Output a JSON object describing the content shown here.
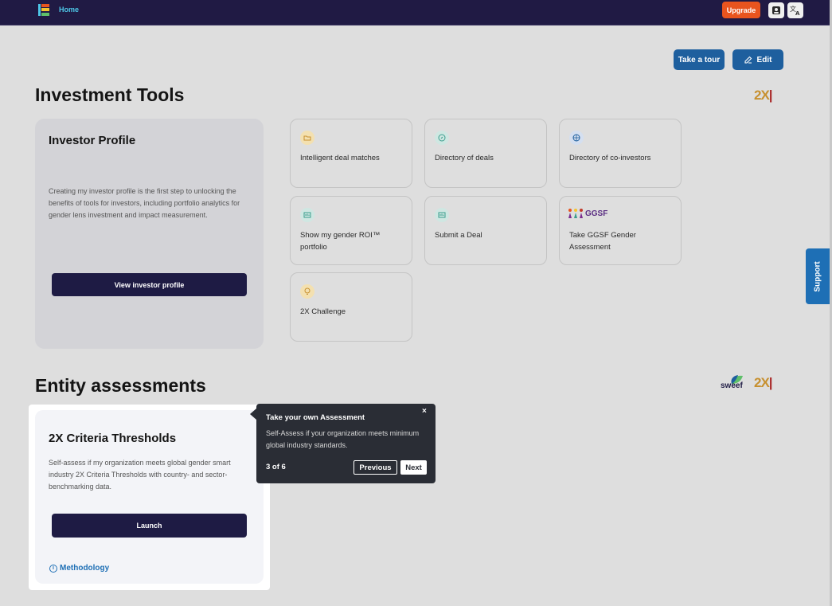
{
  "nav": {
    "home": "Home",
    "upgrade": "Upgrade"
  },
  "toolbar": {
    "tour": "Take a tour",
    "edit": "Edit"
  },
  "investment_tools": {
    "title": "Investment Tools",
    "logo_text": "2X",
    "profile": {
      "title": "Investor Profile",
      "description": "Creating my investor profile is the first step to unlocking the benefits of tools for investors, including portfolio analytics for gender lens investment and impact measurement.",
      "button": "View investor profile"
    },
    "tools": [
      {
        "label": "Intelligent deal matches",
        "icon": "folder-icon"
      },
      {
        "label": "Directory of deals",
        "icon": "compass-icon"
      },
      {
        "label": "Directory of co-investors",
        "icon": "globe-icon"
      },
      {
        "label": "Show my gender ROI™ portfolio",
        "icon": "chart-icon"
      },
      {
        "label": "Submit a Deal",
        "icon": "chart-icon"
      },
      {
        "label": "Take GGSF Gender Assessment",
        "icon": "ggsf-logo",
        "logo_text": "GGSF"
      },
      {
        "label": "2X Challenge",
        "icon": "lightbulb-icon"
      }
    ]
  },
  "entity": {
    "title": "Entity assessments",
    "sweef_text": "sweef",
    "logo_text": "2X",
    "card": {
      "title": "2X Criteria Thresholds",
      "description": "Self-assess if my organization meets global gender smart industry 2X Criteria Thresholds with country- and sector-benchmarking data.",
      "button": "Launch",
      "link": "Methodology"
    }
  },
  "tooltip": {
    "title": "Take your own Assessment",
    "body": "Self-Assess if your organization meets minimum global industry standards.",
    "progress": "3 of 6",
    "prev": "Previous",
    "next": "Next",
    "close": "×"
  },
  "support": "Support",
  "colors": {
    "nav_bg": "#201a44",
    "accent": "#1e5f9e",
    "upgrade": "#e8541e",
    "dark_btn": "#1e1b44"
  }
}
